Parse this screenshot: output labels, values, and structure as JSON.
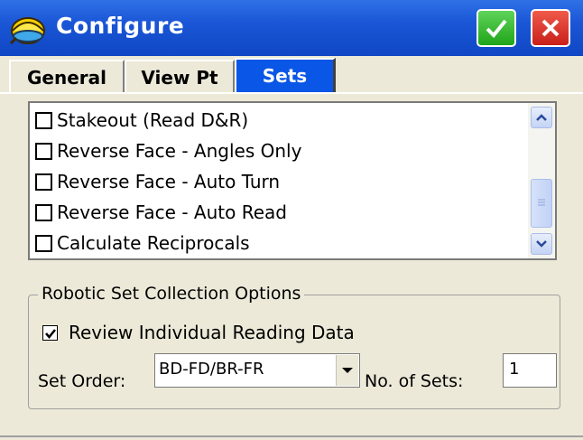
{
  "window": {
    "title": "Configure",
    "ok_icon": "checkmark-icon",
    "close_icon": "close-icon",
    "colors": {
      "titlebar": "#1a56d6",
      "ok": "#20a51a",
      "close": "#c8201a",
      "active_tab": "#0a56e6"
    }
  },
  "tabs": [
    {
      "label": "General",
      "active": false
    },
    {
      "label": "View Pt",
      "active": false
    },
    {
      "label": "Sets",
      "active": true
    }
  ],
  "checklist": {
    "items": [
      {
        "label": "Stakeout (Read D&R)",
        "checked": false
      },
      {
        "label": "Reverse Face - Angles Only",
        "checked": false
      },
      {
        "label": "Reverse Face - Auto Turn",
        "checked": false
      },
      {
        "label": "Reverse Face - Auto Read",
        "checked": false
      },
      {
        "label": "Calculate Reciprocals",
        "checked": false
      }
    ]
  },
  "robotic_options": {
    "legend": "Robotic Set Collection Options",
    "review_label": "Review Individual Reading Data",
    "review_checked": true,
    "set_order_label": "Set Order:",
    "set_order_value": "BD-FD/BR-FR",
    "num_sets_label": "No. of Sets:",
    "num_sets_value": "1"
  }
}
